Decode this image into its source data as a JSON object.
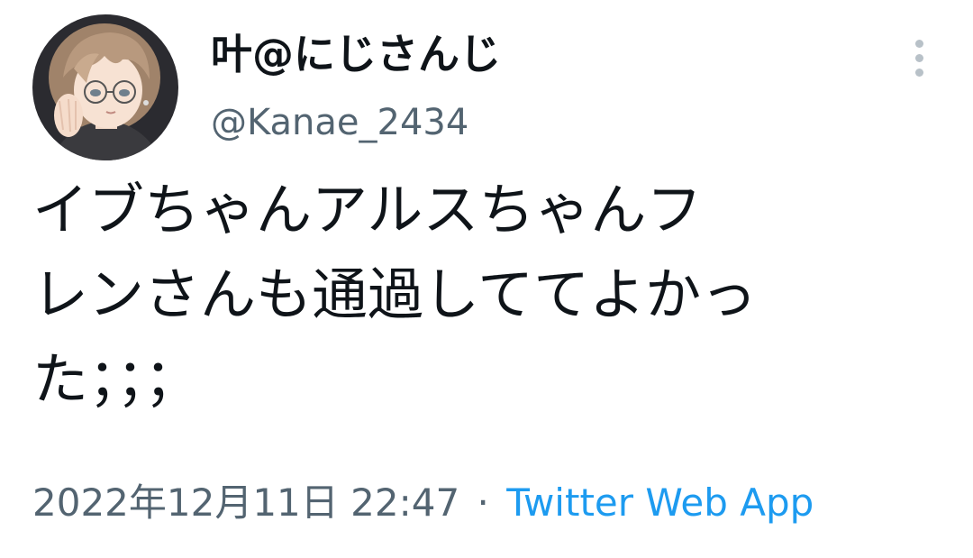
{
  "author": {
    "display_name": "叶@にじさんじ",
    "handle": "@Kanae_2434",
    "avatar_icon": "avatar-illustration"
  },
  "tweet": {
    "text_lines": [
      "イブちゃんアルスちゃんフ",
      "レンさんも通過しててよかっ",
      "た；；；"
    ],
    "timestamp": "2022年12月11日 22:47",
    "separator": "·",
    "source": "Twitter Web App"
  },
  "menu": {
    "icon": "more-vertical-icon"
  },
  "colors": {
    "text": "#0f1419",
    "secondary_text": "#536471",
    "link": "#1d9bf0",
    "menu_dots": "#b8c1c8"
  }
}
